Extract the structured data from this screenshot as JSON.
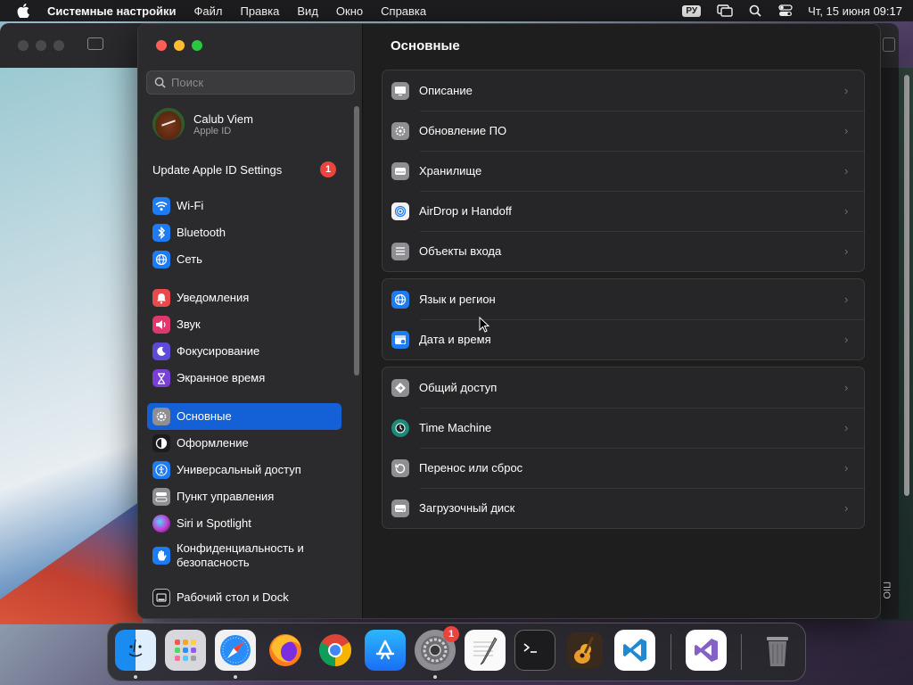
{
  "menubar": {
    "app_name": "Системные настройки",
    "items": [
      "Файл",
      "Правка",
      "Вид",
      "Окно",
      "Справка"
    ],
    "input_source": "РУ",
    "clock": "Чт, 15 июня  09:17"
  },
  "sidebar": {
    "search_placeholder": "Поиск",
    "profile": {
      "name": "Calub Viem",
      "sub": "Apple ID"
    },
    "update": {
      "label": "Update Apple ID Settings",
      "count": "1"
    },
    "items": [
      {
        "label": "Wi-Fi",
        "icon": "wifi-icon",
        "color": "#1e7cf2"
      },
      {
        "label": "Bluetooth",
        "icon": "bluetooth-icon",
        "color": "#1e7cf2"
      },
      {
        "label": "Сеть",
        "icon": "globe-icon",
        "color": "#1e7cf2"
      },
      {
        "label": "Уведомления",
        "icon": "bell-icon",
        "color": "#e84a4a"
      },
      {
        "label": "Звук",
        "icon": "speaker-icon",
        "color": "#e0386b"
      },
      {
        "label": "Фокусирование",
        "icon": "moon-icon",
        "color": "#5e4ad9"
      },
      {
        "label": "Экранное время",
        "icon": "hourglass-icon",
        "color": "#7a3fd6"
      },
      {
        "label": "Основные",
        "icon": "gear-icon",
        "color": "#8e8e93",
        "active": true
      },
      {
        "label": "Оформление",
        "icon": "appearance-icon",
        "color": "#1c1c1e"
      },
      {
        "label": "Универсальный доступ",
        "icon": "accessibility-icon",
        "color": "#1e7cf2"
      },
      {
        "label": "Пункт управления",
        "icon": "control-center-icon",
        "color": "#8e8e93"
      },
      {
        "label": "Siri и Spotlight",
        "icon": "siri-icon",
        "color": "#c13ad1"
      },
      {
        "label": "Конфиденциальность и безопасность",
        "icon": "hand-icon",
        "color": "#1e7cf2"
      },
      {
        "label": "Рабочий стол и Dock",
        "icon": "dock-icon",
        "color": "#1c1c1e"
      }
    ]
  },
  "content": {
    "title": "Основные",
    "groups": [
      [
        {
          "label": "Описание",
          "icon": "display-icon"
        },
        {
          "label": "Обновление ПО",
          "icon": "gear-update-icon"
        },
        {
          "label": "Хранилище",
          "icon": "storage-icon"
        },
        {
          "label": "AirDrop и Handoff",
          "icon": "airdrop-icon"
        },
        {
          "label": "Объекты входа",
          "icon": "list-icon"
        }
      ],
      [
        {
          "label": "Язык и регион",
          "icon": "globe-icon"
        },
        {
          "label": "Дата и время",
          "icon": "calendar-icon"
        }
      ],
      [
        {
          "label": "Общий доступ",
          "icon": "sharing-icon"
        },
        {
          "label": "Time Machine",
          "icon": "time-machine-icon"
        },
        {
          "label": "Перенос или сброс",
          "icon": "reset-icon"
        },
        {
          "label": "Загрузочный диск",
          "icon": "disk-icon"
        }
      ]
    ]
  },
  "dock": {
    "apps": [
      "finder-icon",
      "launchpad-icon",
      "safari-icon",
      "firefox-icon",
      "chrome-icon",
      "app-store-icon",
      "system-settings-icon",
      "textedit-icon",
      "terminal-icon",
      "garageband-icon",
      "vscode-icon",
      "visual-studio-icon",
      "trash-icon"
    ],
    "settings_badge": "1"
  },
  "background_window": {
    "side_text": "ΠΙΟ"
  }
}
